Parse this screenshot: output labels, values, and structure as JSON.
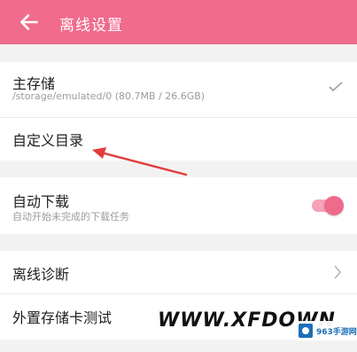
{
  "header": {
    "title": "离线设置",
    "back_icon": "arrow-left-icon",
    "color": "#f06b8c"
  },
  "storage": {
    "label": "主存储",
    "path": "/storage/emulated/0 (80.7MB / 26.6GB)",
    "checked": true
  },
  "custom_dir": {
    "label": "自定义目录"
  },
  "auto_download": {
    "label": "自动下载",
    "description": "自动开始未完成的下载任务",
    "enabled": true
  },
  "diagnosis": {
    "label": "离线诊断"
  },
  "sdcard_test": {
    "label": "外置存储卡测试"
  },
  "watermark": {
    "text": "WWW.XFDOWN",
    "badge": "963手游网"
  }
}
